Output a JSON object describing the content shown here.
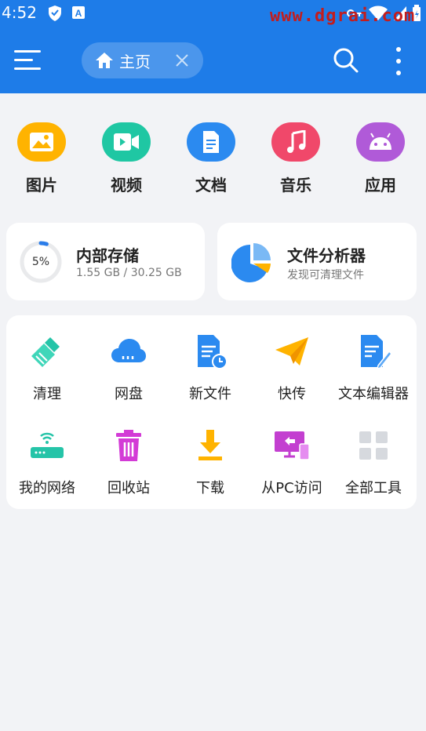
{
  "status_bar": {
    "time": "4:52",
    "watermark": "www.dgrai.com"
  },
  "header": {
    "tab_label": "主页"
  },
  "categories": [
    {
      "label": "图片",
      "icon": "image-icon",
      "color": "#ffb300"
    },
    {
      "label": "视频",
      "icon": "video-icon",
      "color": "#1fc7a3"
    },
    {
      "label": "文档",
      "icon": "document-icon",
      "color": "#2b8af0"
    },
    {
      "label": "音乐",
      "icon": "music-icon",
      "color": "#f0486a"
    },
    {
      "label": "应用",
      "icon": "android-icon",
      "color": "#b05ad8"
    }
  ],
  "storage": {
    "title": "内部存储",
    "percent_label": "5%",
    "percent": 5,
    "usage": "1.55 GB / 30.25 GB"
  },
  "analyzer": {
    "title": "文件分析器",
    "subtitle": "发现可清理文件"
  },
  "tools": [
    {
      "label": "清理",
      "icon": "broom-icon"
    },
    {
      "label": "网盘",
      "icon": "cloud-icon"
    },
    {
      "label": "新文件",
      "icon": "new-file-icon"
    },
    {
      "label": "快传",
      "icon": "paper-plane-icon"
    },
    {
      "label": "文本编辑器",
      "icon": "text-editor-icon"
    },
    {
      "label": "我的网络",
      "icon": "router-icon"
    },
    {
      "label": "回收站",
      "icon": "trash-icon"
    },
    {
      "label": "下载",
      "icon": "download-icon"
    },
    {
      "label": "从PC访问",
      "icon": "pc-access-icon"
    },
    {
      "label": "全部工具",
      "icon": "grid-icon"
    }
  ]
}
